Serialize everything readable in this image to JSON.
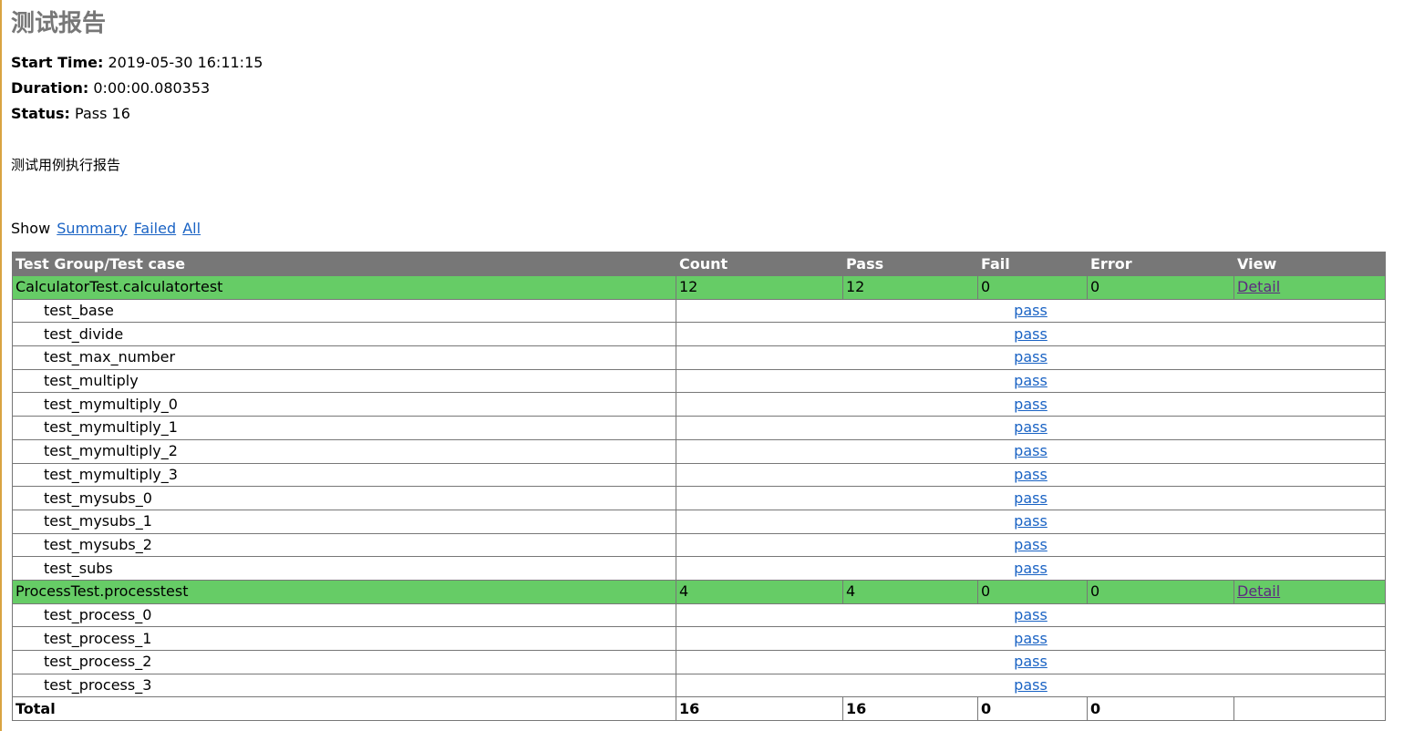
{
  "report": {
    "title": "测试报告",
    "start_time_label": "Start Time:",
    "start_time_value": "2019-05-30 16:11:15",
    "duration_label": "Duration:",
    "duration_value": "0:00:00.080353",
    "status_label": "Status:",
    "status_value": "Pass 16",
    "description": "测试用例执行报告"
  },
  "show_bar": {
    "label": "Show",
    "links": [
      "Summary",
      "Failed",
      "All"
    ]
  },
  "table": {
    "headers": [
      "Test Group/Test case",
      "Count",
      "Pass",
      "Fail",
      "Error",
      "View"
    ],
    "groups": [
      {
        "name": "CalculatorTest.calculatortest",
        "count": "12",
        "pass": "12",
        "fail": "0",
        "error": "0",
        "view": "Detail",
        "cases": [
          {
            "name": "test_base",
            "status": "pass"
          },
          {
            "name": "test_divide",
            "status": "pass"
          },
          {
            "name": "test_max_number",
            "status": "pass"
          },
          {
            "name": "test_multiply",
            "status": "pass"
          },
          {
            "name": "test_mymultiply_0",
            "status": "pass"
          },
          {
            "name": "test_mymultiply_1",
            "status": "pass"
          },
          {
            "name": "test_mymultiply_2",
            "status": "pass"
          },
          {
            "name": "test_mymultiply_3",
            "status": "pass"
          },
          {
            "name": "test_mysubs_0",
            "status": "pass"
          },
          {
            "name": "test_mysubs_1",
            "status": "pass"
          },
          {
            "name": "test_mysubs_2",
            "status": "pass"
          },
          {
            "name": "test_subs",
            "status": "pass"
          }
        ]
      },
      {
        "name": "ProcessTest.processtest",
        "count": "4",
        "pass": "4",
        "fail": "0",
        "error": "0",
        "view": "Detail",
        "cases": [
          {
            "name": "test_process_0",
            "status": "pass"
          },
          {
            "name": "test_process_1",
            "status": "pass"
          },
          {
            "name": "test_process_2",
            "status": "pass"
          },
          {
            "name": "test_process_3",
            "status": "pass"
          }
        ]
      }
    ],
    "total": {
      "label": "Total",
      "count": "16",
      "pass": "16",
      "fail": "0",
      "error": "0"
    }
  }
}
